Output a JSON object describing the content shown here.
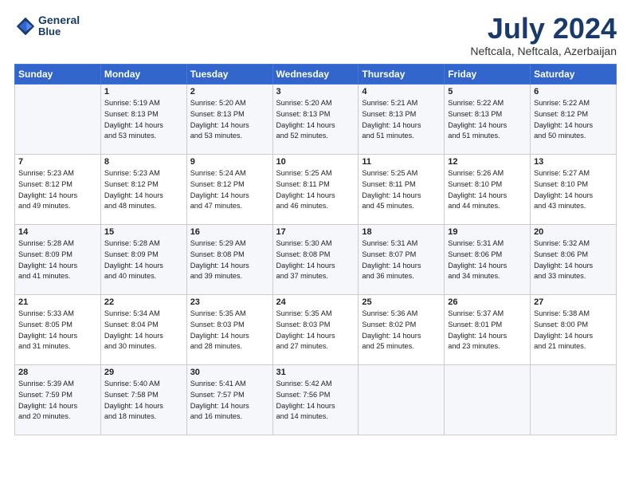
{
  "header": {
    "logo_line1": "General",
    "logo_line2": "Blue",
    "title": "July 2024",
    "location": "Neftcala, Neftcala, Azerbaijan"
  },
  "weekdays": [
    "Sunday",
    "Monday",
    "Tuesday",
    "Wednesday",
    "Thursday",
    "Friday",
    "Saturday"
  ],
  "weeks": [
    [
      {
        "day": "",
        "info": ""
      },
      {
        "day": "1",
        "info": "Sunrise: 5:19 AM\nSunset: 8:13 PM\nDaylight: 14 hours\nand 53 minutes."
      },
      {
        "day": "2",
        "info": "Sunrise: 5:20 AM\nSunset: 8:13 PM\nDaylight: 14 hours\nand 53 minutes."
      },
      {
        "day": "3",
        "info": "Sunrise: 5:20 AM\nSunset: 8:13 PM\nDaylight: 14 hours\nand 52 minutes."
      },
      {
        "day": "4",
        "info": "Sunrise: 5:21 AM\nSunset: 8:13 PM\nDaylight: 14 hours\nand 51 minutes."
      },
      {
        "day": "5",
        "info": "Sunrise: 5:22 AM\nSunset: 8:13 PM\nDaylight: 14 hours\nand 51 minutes."
      },
      {
        "day": "6",
        "info": "Sunrise: 5:22 AM\nSunset: 8:12 PM\nDaylight: 14 hours\nand 50 minutes."
      }
    ],
    [
      {
        "day": "7",
        "info": "Sunrise: 5:23 AM\nSunset: 8:12 PM\nDaylight: 14 hours\nand 49 minutes."
      },
      {
        "day": "8",
        "info": "Sunrise: 5:23 AM\nSunset: 8:12 PM\nDaylight: 14 hours\nand 48 minutes."
      },
      {
        "day": "9",
        "info": "Sunrise: 5:24 AM\nSunset: 8:12 PM\nDaylight: 14 hours\nand 47 minutes."
      },
      {
        "day": "10",
        "info": "Sunrise: 5:25 AM\nSunset: 8:11 PM\nDaylight: 14 hours\nand 46 minutes."
      },
      {
        "day": "11",
        "info": "Sunrise: 5:25 AM\nSunset: 8:11 PM\nDaylight: 14 hours\nand 45 minutes."
      },
      {
        "day": "12",
        "info": "Sunrise: 5:26 AM\nSunset: 8:10 PM\nDaylight: 14 hours\nand 44 minutes."
      },
      {
        "day": "13",
        "info": "Sunrise: 5:27 AM\nSunset: 8:10 PM\nDaylight: 14 hours\nand 43 minutes."
      }
    ],
    [
      {
        "day": "14",
        "info": "Sunrise: 5:28 AM\nSunset: 8:09 PM\nDaylight: 14 hours\nand 41 minutes."
      },
      {
        "day": "15",
        "info": "Sunrise: 5:28 AM\nSunset: 8:09 PM\nDaylight: 14 hours\nand 40 minutes."
      },
      {
        "day": "16",
        "info": "Sunrise: 5:29 AM\nSunset: 8:08 PM\nDaylight: 14 hours\nand 39 minutes."
      },
      {
        "day": "17",
        "info": "Sunrise: 5:30 AM\nSunset: 8:08 PM\nDaylight: 14 hours\nand 37 minutes."
      },
      {
        "day": "18",
        "info": "Sunrise: 5:31 AM\nSunset: 8:07 PM\nDaylight: 14 hours\nand 36 minutes."
      },
      {
        "day": "19",
        "info": "Sunrise: 5:31 AM\nSunset: 8:06 PM\nDaylight: 14 hours\nand 34 minutes."
      },
      {
        "day": "20",
        "info": "Sunrise: 5:32 AM\nSunset: 8:06 PM\nDaylight: 14 hours\nand 33 minutes."
      }
    ],
    [
      {
        "day": "21",
        "info": "Sunrise: 5:33 AM\nSunset: 8:05 PM\nDaylight: 14 hours\nand 31 minutes."
      },
      {
        "day": "22",
        "info": "Sunrise: 5:34 AM\nSunset: 8:04 PM\nDaylight: 14 hours\nand 30 minutes."
      },
      {
        "day": "23",
        "info": "Sunrise: 5:35 AM\nSunset: 8:03 PM\nDaylight: 14 hours\nand 28 minutes."
      },
      {
        "day": "24",
        "info": "Sunrise: 5:35 AM\nSunset: 8:03 PM\nDaylight: 14 hours\nand 27 minutes."
      },
      {
        "day": "25",
        "info": "Sunrise: 5:36 AM\nSunset: 8:02 PM\nDaylight: 14 hours\nand 25 minutes."
      },
      {
        "day": "26",
        "info": "Sunrise: 5:37 AM\nSunset: 8:01 PM\nDaylight: 14 hours\nand 23 minutes."
      },
      {
        "day": "27",
        "info": "Sunrise: 5:38 AM\nSunset: 8:00 PM\nDaylight: 14 hours\nand 21 minutes."
      }
    ],
    [
      {
        "day": "28",
        "info": "Sunrise: 5:39 AM\nSunset: 7:59 PM\nDaylight: 14 hours\nand 20 minutes."
      },
      {
        "day": "29",
        "info": "Sunrise: 5:40 AM\nSunset: 7:58 PM\nDaylight: 14 hours\nand 18 minutes."
      },
      {
        "day": "30",
        "info": "Sunrise: 5:41 AM\nSunset: 7:57 PM\nDaylight: 14 hours\nand 16 minutes."
      },
      {
        "day": "31",
        "info": "Sunrise: 5:42 AM\nSunset: 7:56 PM\nDaylight: 14 hours\nand 14 minutes."
      },
      {
        "day": "",
        "info": ""
      },
      {
        "day": "",
        "info": ""
      },
      {
        "day": "",
        "info": ""
      }
    ]
  ]
}
